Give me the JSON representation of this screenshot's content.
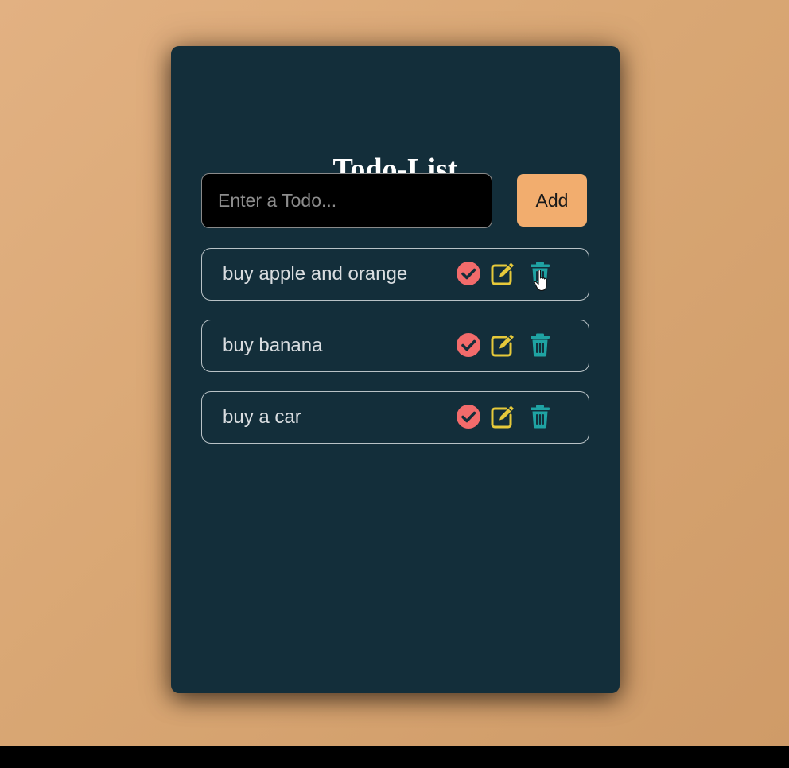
{
  "app": {
    "title": "Todo-List"
  },
  "input": {
    "placeholder": "Enter a Todo...",
    "value": ""
  },
  "add_button": {
    "label": "Add"
  },
  "todos": [
    {
      "text": "buy apple and orange"
    },
    {
      "text": "buy banana"
    },
    {
      "text": "buy a car"
    }
  ],
  "icons": {
    "complete": "check-circle-icon",
    "edit": "edit-icon",
    "delete": "trash-icon"
  },
  "colors": {
    "card_background": "#132e3a",
    "add_button": "#f2ad6e",
    "check_icon": "#f26b6b",
    "edit_icon": "#e6c93a",
    "trash_icon": "#1fa3a3",
    "page_background": "#dcab78"
  }
}
